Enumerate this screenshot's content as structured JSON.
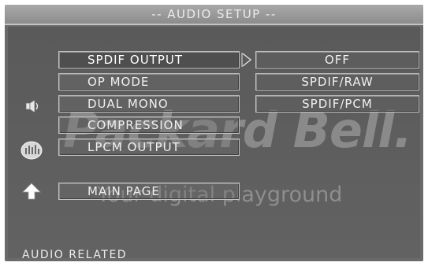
{
  "header": {
    "title": "-- AUDIO SETUP --"
  },
  "watermark": {
    "brand": "Packard Bell.",
    "tagline": "Your digital playground"
  },
  "menu": {
    "items": [
      {
        "label": "SPDIF OUTPUT"
      },
      {
        "label": "OP MODE"
      },
      {
        "label": "DUAL MONO"
      },
      {
        "label": "COMPRESSION"
      },
      {
        "label": "LPCM OUTPUT"
      }
    ],
    "main_page": "MAIN PAGE"
  },
  "options": [
    {
      "label": "OFF"
    },
    {
      "label": "SPDIF/RAW"
    },
    {
      "label": "SPDIF/PCM"
    }
  ],
  "icons": {
    "side": [
      "speaker-icon",
      "equalizer-icon",
      "up-arrow-icon"
    ],
    "submenu": "chevron-right-icon"
  },
  "status": {
    "text": "AUDIO RELATED"
  },
  "selected": {
    "menu": "SPDIF OUTPUT"
  }
}
